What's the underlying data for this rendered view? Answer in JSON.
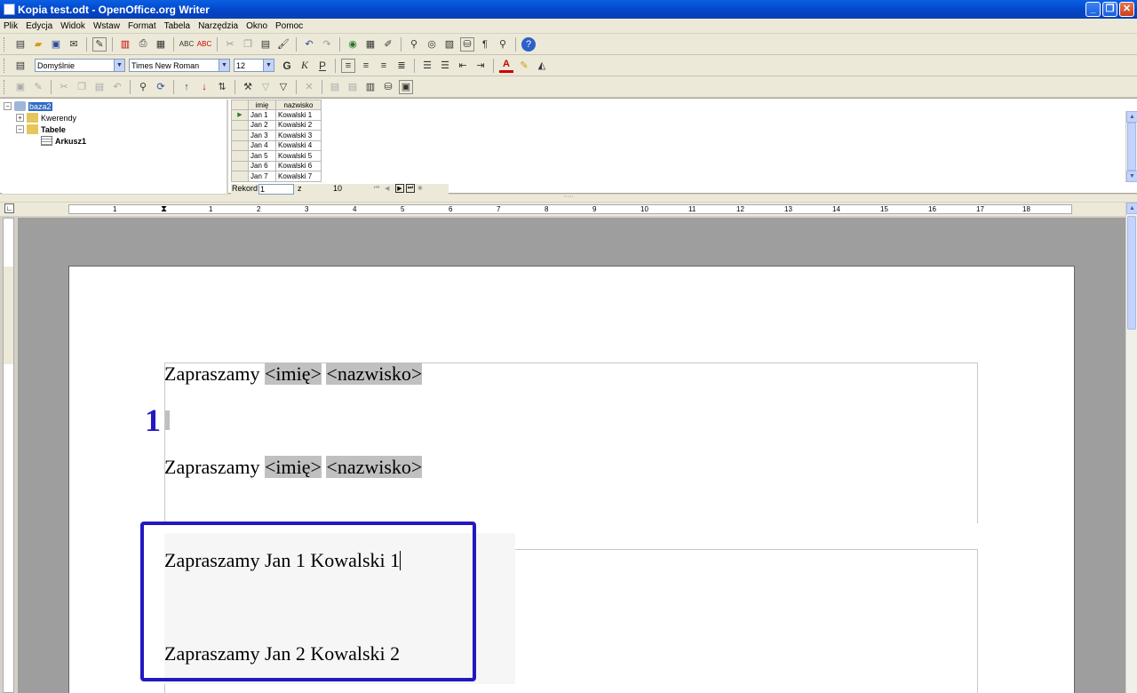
{
  "window": {
    "title": "Kopia test.odt - OpenOffice.org Writer"
  },
  "menu": [
    "Plik",
    "Edycja",
    "Widok",
    "Wstaw",
    "Format",
    "Tabela",
    "Narzędzia",
    "Okno",
    "Pomoc"
  ],
  "formatting": {
    "style": "Domyślnie",
    "font": "Times New Roman",
    "size": "12",
    "bold": "G",
    "italic": "K",
    "underline": "P"
  },
  "tree": {
    "root": "baza2",
    "queries": "Kwerendy",
    "tables": "Tabele",
    "sheet": "Arkusz1"
  },
  "grid": {
    "columns": [
      "imię",
      "nazwisko"
    ],
    "rows": [
      [
        "Jan 1",
        "Kowalski 1"
      ],
      [
        "Jan 2",
        "Kowalski 2"
      ],
      [
        "Jan 3",
        "Kowalski 3"
      ],
      [
        "Jan 4",
        "Kowalski 4"
      ],
      [
        "Jan 5",
        "Kowalski 5"
      ],
      [
        "Jan 6",
        "Kowalski 6"
      ],
      [
        "Jan 7",
        "Kowalski 7"
      ]
    ]
  },
  "navigator": {
    "record_label": "Rekord",
    "record_value": "1",
    "of_label": "z",
    "total": "10"
  },
  "ruler": {
    "ticks": [
      "1",
      "1",
      "2",
      "3",
      "4",
      "5",
      "6",
      "7",
      "8",
      "9",
      "10",
      "11",
      "12",
      "13",
      "14",
      "15",
      "16",
      "17",
      "18"
    ]
  },
  "document": {
    "template": {
      "prefix": "Zapraszamy",
      "field1": "<imię>",
      "field2": "<nazwisko>"
    },
    "annotation_number": "1",
    "merged": [
      "Zapraszamy Jan 1 Kowalski 1",
      "Zapraszamy Jan 2 Kowalski 2"
    ]
  },
  "colors": {
    "highlight_border": "#2318c0",
    "title_bar": "#0346c9",
    "field_shading": "#c0c0c0"
  }
}
